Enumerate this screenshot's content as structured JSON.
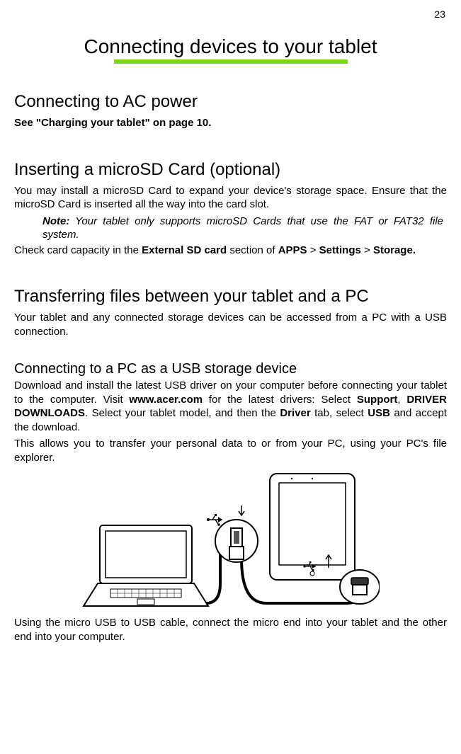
{
  "page_number": "23",
  "title": "Connecting devices to your tablet",
  "sections": {
    "ac_power": {
      "heading": "Connecting to AC power",
      "text": "See \"Charging your tablet\" on page 10."
    },
    "microsd": {
      "heading": "Inserting a microSD Card (optional)",
      "p1": "You may install a microSD Card to expand your device's storage space. Ensure that the microSD Card is inserted all the way into the card slot.",
      "note_label": "Note:",
      "note_text": " Your tablet only supports microSD Cards that use the FAT or FAT32 file system.",
      "p2_prefix": "Check card capacity in the ",
      "p2_b1": "External SD card",
      "p2_mid1": " section of ",
      "p2_b2": "APPS",
      "p2_gt1": " > ",
      "p2_b3": "Settings",
      "p2_gt2": " > ",
      "p2_b4": "Storage."
    },
    "transfer": {
      "heading": "Transferring files between your tablet and a PC",
      "p1": "Your tablet and any connected storage devices can be accessed from a PC with a USB connection."
    },
    "pc_usb": {
      "heading": "Connecting to a PC as a USB storage device",
      "p1_pre": "Download and install the latest USB driver on your computer before connecting your tablet to the computer. Visit ",
      "p1_b1": "www.acer.com",
      "p1_mid1": " for the latest drivers: Select ",
      "p1_b2": "Support",
      "p1_mid2": ", ",
      "p1_b3": "DRIVER DOWNLOADS",
      "p1_mid3": ". Select your tablet model, and then the ",
      "p1_b4": "Driver",
      "p1_mid4": " tab, select ",
      "p1_b5": "USB",
      "p1_mid5": " and accept the download.",
      "p2": "This allows you to transfer your personal data to or from your PC, using your PC's file explorer.",
      "p3": "Using the micro USB to USB cable, connect the micro end into your tablet and the other end into your computer."
    }
  }
}
